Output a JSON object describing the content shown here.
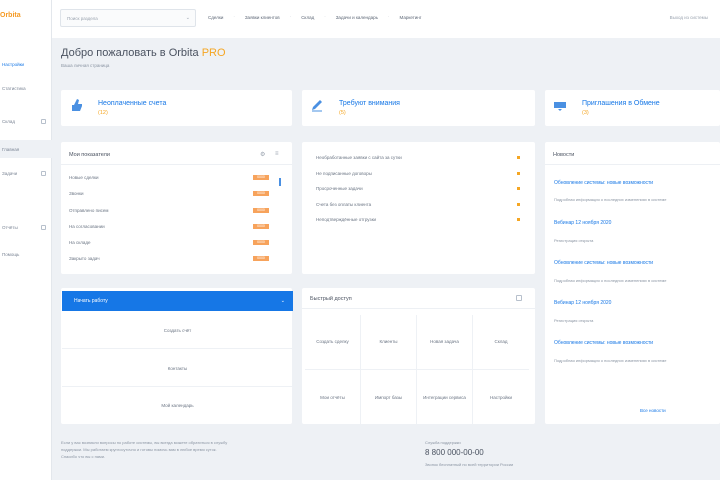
{
  "sidebar": {
    "logo": "Orbita",
    "items": [
      {
        "label": "Настройки",
        "link": true
      },
      {
        "label": "Статистика",
        "link": false
      },
      {
        "label": "Склад",
        "link": false
      },
      {
        "label": "Главная",
        "link": false
      },
      {
        "label": "Задачи",
        "link": false
      },
      {
        "label": "Отчёты",
        "link": false
      },
      {
        "label": "Помощь",
        "link": false
      }
    ]
  },
  "topbar": {
    "search_placeholder": "Поиск раздела",
    "nav": [
      "Сделки",
      "Заявки клиентов",
      "Склад",
      "Задачи и календарь",
      "Маркетинг"
    ],
    "right_text": "Выход из системы"
  },
  "header": {
    "title": "Добро пожаловать в Orbita",
    "title_accent": "PRO",
    "subtitle": "Ваша личная страница"
  },
  "stats": [
    {
      "label": "Неоплаченные счета",
      "value": "(12)",
      "icon": "thumbs-up-icon"
    },
    {
      "label": "Требуют внимания",
      "value": "(5)",
      "icon": "edit-icon"
    },
    {
      "label": "Приглашения в Обмене",
      "value": "(3)",
      "icon": "mail-icon"
    }
  ],
  "dashboard": {
    "title": "Мои показатели",
    "rows": [
      {
        "label": "Новые сделки",
        "value": "0000"
      },
      {
        "label": "Звонки",
        "value": "0000"
      },
      {
        "label": "Отправлено писем",
        "value": "0000"
      },
      {
        "label": "На согласовании",
        "value": "0000"
      },
      {
        "label": "На складе",
        "value": "0000"
      },
      {
        "label": "Закрыто задач",
        "value": "0000"
      }
    ]
  },
  "task_list": [
    "Необработанные заявки с сайта за сутки",
    "Не подписанные договоры",
    "Просроченные задачи",
    "Счета без оплаты клиента",
    "Неподтверждённые отгрузки"
  ],
  "actions": {
    "primary": "Начать работу",
    "links": [
      "Создать счёт",
      "Контакты",
      "Мой календарь"
    ]
  },
  "quick": {
    "title": "Быстрый доступ",
    "cells": [
      "Создать сделку",
      "Клиенты",
      "Новая задача",
      "Склад",
      "Мои отчёты",
      "Импорт базы",
      "Интеграции сервиса",
      "Настройки"
    ]
  },
  "news": {
    "title": "Новости",
    "items": [
      {
        "title": "Обновление системы: новые возможности",
        "desc": "Подробная информация о последних изменениях в системе"
      },
      {
        "title": "Вебинар 12 ноября 2020",
        "desc": "Регистрация открыта"
      },
      {
        "title": "Обновление системы: новые возможности",
        "desc": "Подробная информация о последних изменениях в системе"
      },
      {
        "title": "Вебинар 12 ноября 2020",
        "desc": "Регистрация открыта"
      },
      {
        "title": "Обновление системы: новые возможности",
        "desc": "Подробная информация о последних изменениях в системе"
      }
    ],
    "more": "Все новости"
  },
  "footer": {
    "lines": [
      "Если у вас возникли вопросы по работе системы, вы всегда можете обратиться в службу",
      "поддержки. Мы работаем круглосуточно и готовы помочь вам в любое время суток.",
      "Спасибо что вы с нами."
    ],
    "contact_label": "Служба поддержки",
    "contact_phone": "8 800 000-00-00",
    "contact_note": "Звонок бесплатный по всей территории России"
  }
}
